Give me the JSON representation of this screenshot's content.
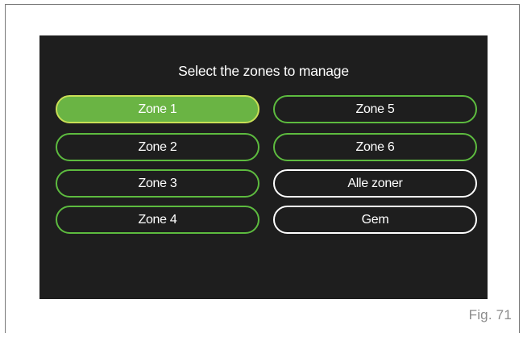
{
  "screen": {
    "title": "Select the zones to manage",
    "buttons_left": [
      {
        "label": "Zone 1",
        "selected": true
      },
      {
        "label": "Zone 2",
        "selected": false
      },
      {
        "label": "Zone 3",
        "selected": false
      },
      {
        "label": "Zone 4",
        "selected": false
      }
    ],
    "buttons_right": [
      {
        "label": "Zone 5",
        "selected": false
      },
      {
        "label": "Zone 6",
        "selected": false
      },
      {
        "label": "Alle zoner",
        "selected": false
      },
      {
        "label": "Gem",
        "selected": false
      }
    ]
  },
  "figure_label": "Fig. 71",
  "colors": {
    "screen_background": "#1e1e1e",
    "zone_border": "#5dbb3f",
    "selected_fill": "#6ab444",
    "selected_border": "#c9df56",
    "action_border": "#ffffff"
  }
}
